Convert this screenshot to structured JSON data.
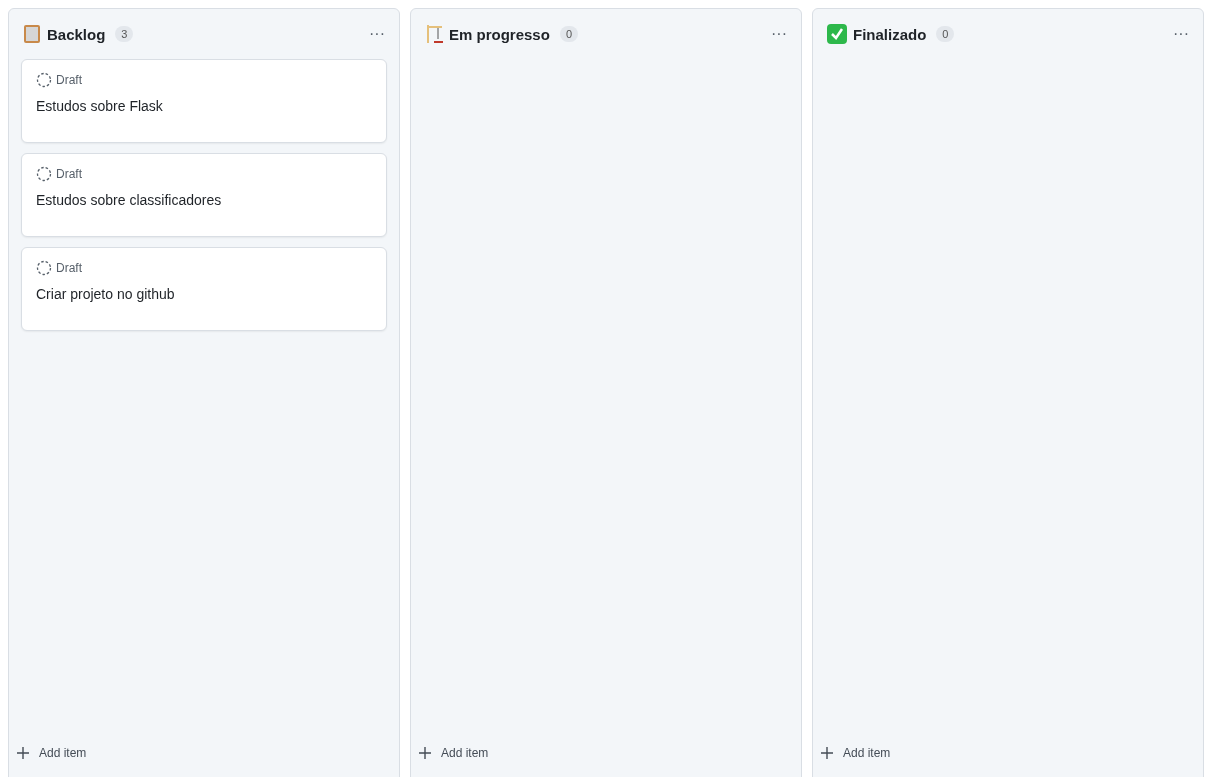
{
  "columns": [
    {
      "kind": "clipboard",
      "title": "Backlog",
      "count": "3",
      "menu": "···",
      "add_label": "Add item",
      "cards": [
        {
          "status": "Draft",
          "title": "Estudos sobre Flask"
        },
        {
          "status": "Draft",
          "title": "Estudos sobre classificadores"
        },
        {
          "status": "Draft",
          "title": "Criar projeto no github"
        }
      ]
    },
    {
      "kind": "crane",
      "title": "Em progresso",
      "count": "0",
      "menu": "···",
      "add_label": "Add item"
    },
    {
      "kind": "check",
      "title": "Finalizado",
      "count": "0",
      "menu": "···",
      "add_label": "Add item"
    }
  ]
}
